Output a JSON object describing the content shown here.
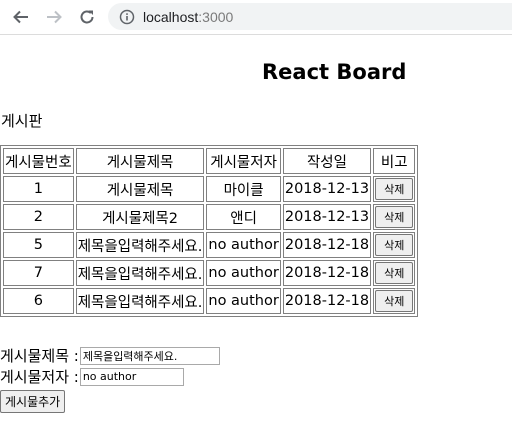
{
  "browser": {
    "url_host": "localhost",
    "url_port": ":3000",
    "icons": [
      "back-arrow-icon",
      "forward-arrow-icon",
      "reload-icon",
      "info-icon"
    ]
  },
  "page": {
    "title": "React Board",
    "section_label": "게시판"
  },
  "board": {
    "headers": [
      "게시물번호",
      "게시물제목",
      "게시물저자",
      "작성일",
      "비고"
    ],
    "rows": [
      {
        "no": "1",
        "title": "게시물제목",
        "author": "마이클",
        "date": "2018-12-13",
        "action": "삭제"
      },
      {
        "no": "2",
        "title": "게시물제목2",
        "author": "앤디",
        "date": "2018-12-13",
        "action": "삭제"
      },
      {
        "no": "5",
        "title": "제목을입력해주세요.",
        "author": "no author",
        "date": "2018-12-18",
        "action": "삭제"
      },
      {
        "no": "7",
        "title": "제목을입력해주세요.",
        "author": "no author",
        "date": "2018-12-18",
        "action": "삭제"
      },
      {
        "no": "6",
        "title": "제목을입력해주세요.",
        "author": "no author",
        "date": "2018-12-18",
        "action": "삭제"
      }
    ]
  },
  "form": {
    "title_label": "게시물제목 :",
    "title_value": "제목을입력해주세요.",
    "author_label": "게시물저자 :",
    "author_value": "no author",
    "submit_label": "게시물추가"
  }
}
